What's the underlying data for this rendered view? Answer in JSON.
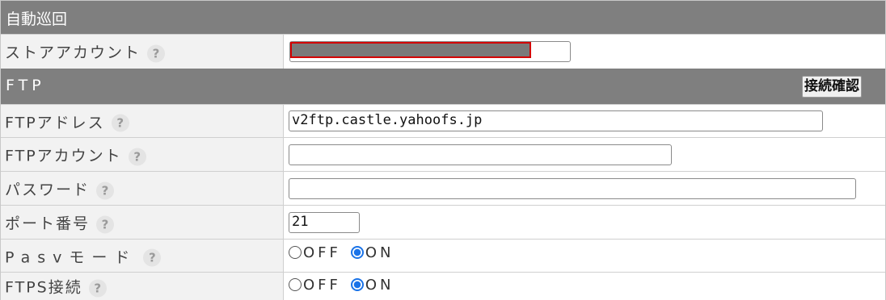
{
  "sections": {
    "auto_patrol_title": "自動巡回",
    "ftp_title": "FTP",
    "connection_check_button": "接続確認"
  },
  "help_glyph": "?",
  "fields": {
    "store_account": {
      "label": "ストアアカウント",
      "value": ""
    },
    "ftp_address": {
      "label": "FTPアドレス",
      "value": "v2ftp.castle.yahoofs.jp"
    },
    "ftp_account": {
      "label": "FTPアカウント",
      "value": ""
    },
    "password": {
      "label": "パスワード",
      "value": ""
    },
    "port": {
      "label": "ポート番号",
      "value": "21"
    },
    "pasv_mode": {
      "label": "Pasvモード",
      "options": [
        "OFF",
        "ON"
      ],
      "selected": "ON"
    },
    "ftps": {
      "label": "FTPS接続",
      "options": [
        "OFF",
        "ON"
      ],
      "selected": "ON"
    }
  },
  "colors": {
    "header_bg": "#7f7f7f",
    "label_bg": "#f2f2f2",
    "redaction_fill": "#7a7a7a",
    "redaction_border": "#d40000",
    "radio_selected": "#1a73e8"
  }
}
